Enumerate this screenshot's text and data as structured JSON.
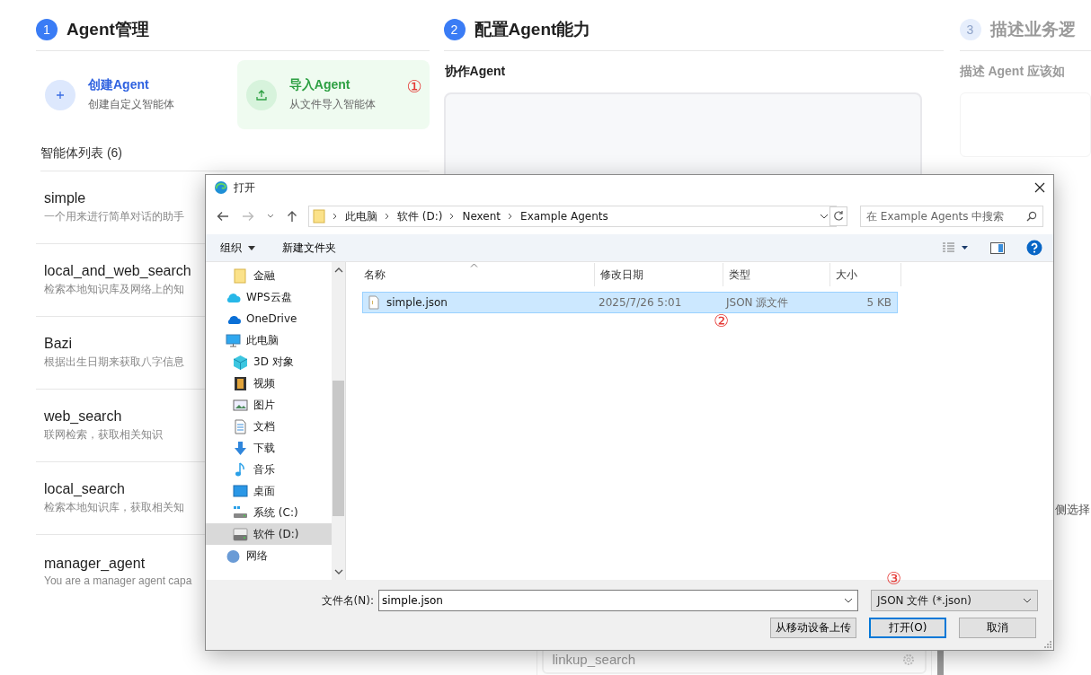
{
  "steps": [
    {
      "number": "1",
      "title": "Agent管理",
      "faded": false
    },
    {
      "number": "2",
      "title": "配置Agent能力",
      "faded": false
    },
    {
      "number": "3",
      "title": "描述业务逻",
      "faded": true
    }
  ],
  "agent_actions": [
    {
      "kind": "create",
      "title": "创建Agent",
      "subtitle": "创建自定义智能体",
      "highlighted": false
    },
    {
      "kind": "import",
      "title": "导入Agent",
      "subtitle": "从文件导入智能体",
      "highlighted": true,
      "annotation": "①"
    }
  ],
  "agent_list": {
    "heading": "智能体列表 (6)",
    "items": [
      {
        "name": "simple",
        "description": "一个用来进行简单对话的助手"
      },
      {
        "name": "local_and_web_search",
        "description": "检索本地知识库及网络上的知"
      },
      {
        "name": "Bazi",
        "description": "根据出生日期来获取八字信息"
      },
      {
        "name": "web_search",
        "description": "联网检索，获取相关知识"
      },
      {
        "name": "local_search",
        "description": "检索本地知识库，获取相关知"
      },
      {
        "name": "manager_agent",
        "description": "You are a manager agent capa"
      }
    ]
  },
  "capabilities": {
    "collab_label": "协作Agent",
    "tools": [
      {
        "name": "linkup_search"
      }
    ]
  },
  "business": {
    "subtitle": "描述 Agent 应该如",
    "hint": "侧选择"
  },
  "dialog": {
    "title": "打开",
    "path": [
      "此电脑",
      "软件 (D:)",
      "Nexent",
      "Example Agents"
    ],
    "search_placeholder": "在 Example Agents 中搜索",
    "toolbar": [
      "组织",
      "新建文件夹"
    ],
    "nav": [
      {
        "label": "金融",
        "kind": "folder",
        "selected": false
      },
      {
        "label": "WPS云盘",
        "kind": "wps",
        "selected": false
      },
      {
        "label": "OneDrive",
        "kind": "onedrive",
        "selected": false
      },
      {
        "label": "此电脑",
        "kind": "pc",
        "selected": false,
        "children": [
          {
            "label": "3D 对象",
            "kind": "cube",
            "selected": false
          },
          {
            "label": "视频",
            "kind": "video",
            "selected": false
          },
          {
            "label": "图片",
            "kind": "image",
            "selected": false
          },
          {
            "label": "文档",
            "kind": "doc",
            "selected": false
          },
          {
            "label": "下载",
            "kind": "download",
            "selected": false
          },
          {
            "label": "音乐",
            "kind": "music",
            "selected": false
          },
          {
            "label": "桌面",
            "kind": "desktop",
            "selected": false
          },
          {
            "label": "系统 (C:)",
            "kind": "sysdrive",
            "selected": false
          },
          {
            "label": "软件 (D:)",
            "kind": "drive",
            "selected": true
          }
        ]
      },
      {
        "label": "网络",
        "kind": "network",
        "selected": false
      }
    ],
    "columns": [
      "名称",
      "修改日期",
      "类型",
      "大小"
    ],
    "files": [
      {
        "name": "simple.json",
        "modified": "2025/7/26 5:01",
        "type": "JSON 源文件",
        "size": "5 KB",
        "selected": true,
        "annotation": "②"
      }
    ],
    "filename_label": "文件名(N):",
    "filename": "simple.json",
    "filter": "JSON 文件 (*.json)",
    "filter_annotation": "③",
    "buttons": [
      {
        "label": "从移动设备上传",
        "primary": false
      },
      {
        "label": "打开(O)",
        "primary": true
      },
      {
        "label": "取消",
        "primary": false
      }
    ]
  }
}
